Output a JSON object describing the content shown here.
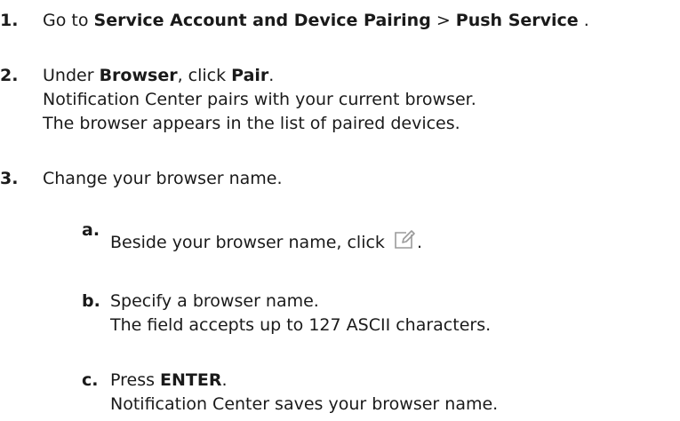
{
  "steps": [
    {
      "number": "1.",
      "text_prefix": "Go to ",
      "bold_1": "Service Account and Device Pairing",
      "separator": " > ",
      "bold_2": "Push Service",
      "text_suffix": " ."
    },
    {
      "number": "2.",
      "text_prefix": "Under ",
      "bold_1": "Browser",
      "text_middle": ", click ",
      "bold_2": "Pair",
      "text_suffix": ".",
      "result_line_1": "Notification Center pairs with your current browser.",
      "result_line_2": "The browser appears in the list of paired devices."
    },
    {
      "number": "3.",
      "text": "Change your browser name.",
      "substeps": [
        {
          "letter": "a.",
          "text": "Beside your browser name, click ",
          "icon": "edit-icon",
          "text_suffix": "."
        },
        {
          "letter": "b.",
          "text": "Specify a browser name.",
          "result": "The field accepts up to 127 ASCII characters."
        },
        {
          "letter": "c.",
          "text_prefix": "Press ",
          "bold": "ENTER",
          "text_suffix": ".",
          "result": "Notification Center saves your browser name."
        }
      ]
    }
  ]
}
